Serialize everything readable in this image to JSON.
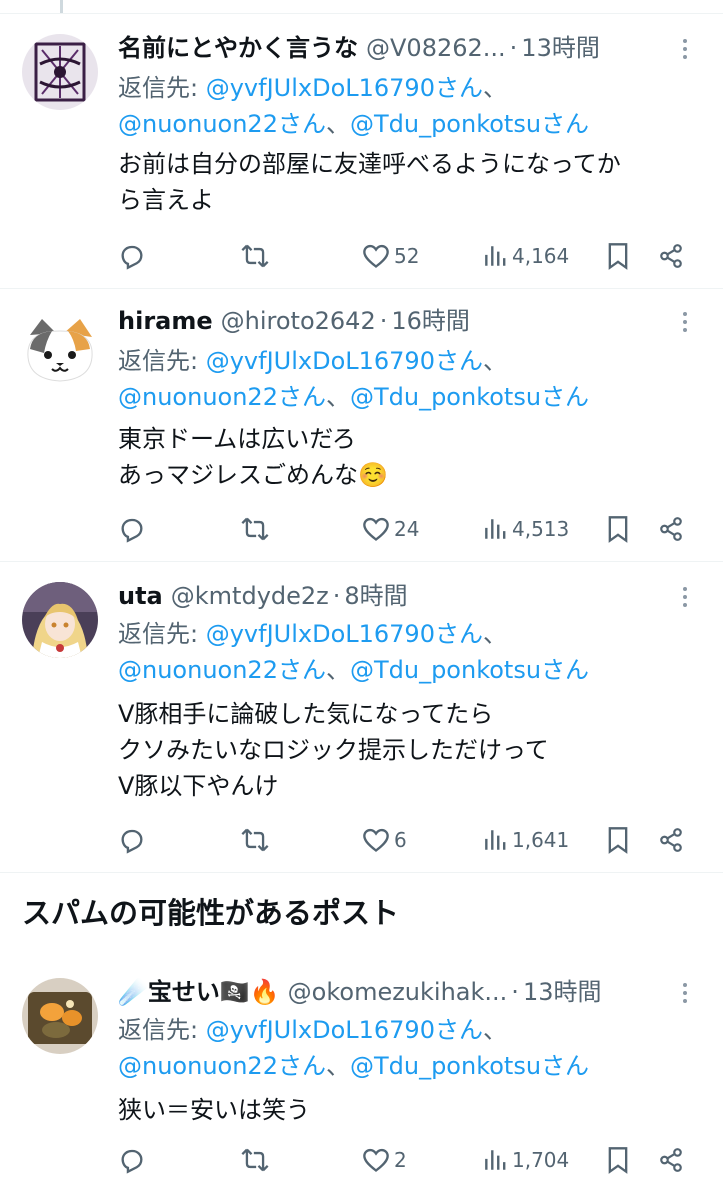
{
  "colors": {
    "link": "#1d9bf0",
    "secondary": "#536471",
    "text": "#0f1419",
    "divider": "#eff3f4"
  },
  "icons": [
    "reply-icon",
    "retweet-icon",
    "like-icon",
    "views-icon",
    "bookmark-icon",
    "share-icon",
    "more-icon"
  ],
  "posts": [
    {
      "name": "名前にとやかく言うな",
      "handle": "@V08262...",
      "time": "13時間",
      "replying_prefix": "返信先: ",
      "mention1": "@yvfJUlxDoL16790",
      "mention2": "@nuonuon22",
      "mention3": "@Tdu_ponkotsu",
      "san": "さん",
      "sep": "、",
      "text_lines": [
        "お前は自分の部屋に友達呼べるようになってか",
        "ら言えよ"
      ],
      "likes": "52",
      "views": "4,164"
    },
    {
      "name": "hirame",
      "handle": "@hiroto2642",
      "time": "16時間",
      "replying_prefix": "返信先: ",
      "mention1": "@yvfJUlxDoL16790",
      "mention2": "@nuonuon22",
      "mention3": "@Tdu_ponkotsu",
      "san": "さん",
      "sep": "、",
      "text_lines": [
        "東京ドームは広いだろ",
        "あっマジレスごめんな☺️"
      ],
      "likes": "24",
      "views": "4,513"
    },
    {
      "name": "uta",
      "handle": "@kmtdyde2z",
      "time": "8時間",
      "replying_prefix": "返信先: ",
      "mention1": "@yvfJUlxDoL16790",
      "mention2": "@nuonuon22",
      "mention3": "@Tdu_ponkotsu",
      "san": "さん",
      "sep": "、",
      "text_lines": [
        "V豚相手に論破した気になってたら",
        "クソみたいなロジック提示しただけって",
        "V豚以下やんけ"
      ],
      "likes": "6",
      "views": "1,641"
    },
    {
      "name": "宝せい",
      "name_prefix_emoji": "☄️",
      "name_suffix_emoji": "🏴‍☠️🔥",
      "handle": "@okomezukihak...",
      "time": "13時間",
      "replying_prefix": "返信先: ",
      "mention1": "@yvfJUlxDoL16790",
      "mention2": "@nuonuon22",
      "mention3": "@Tdu_ponkotsu",
      "san": "さん",
      "sep": "、",
      "text_lines": [
        "狭い＝安いは笑う"
      ],
      "likes": "2",
      "views": "1,704"
    }
  ],
  "section": {
    "spam_title": "スパムの可能性があるポスト"
  },
  "dot_separator": "·"
}
